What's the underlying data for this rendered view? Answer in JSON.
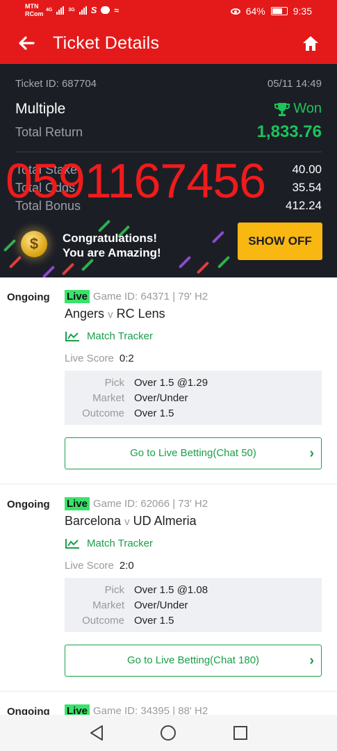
{
  "status_bar": {
    "carrier_top": "MTN",
    "carrier_bottom": "RCom",
    "net1": "4G",
    "net2": "3G",
    "battery_pct": "64%",
    "time": "9:35"
  },
  "header": {
    "title": "Ticket Details"
  },
  "summary": {
    "ticket_id": "Ticket ID: 687704",
    "date": "05/11 14:49",
    "bet_type": "Multiple",
    "result": "Won",
    "total_return_label": "Total Return",
    "total_return": "1,833.76",
    "total_stake_label": "Total Stake",
    "total_stake": "40.00",
    "total_odds_label": "Total Odds",
    "total_odds": "35.54",
    "total_bonus_label": "Total Bonus",
    "total_bonus": "412.24",
    "watermark": "0591167456",
    "congrats_line1": "Congratulations!",
    "congrats_line2": "You are Amazing!",
    "show_off": "SHOW OFF"
  },
  "bets": [
    {
      "state": "Ongoing",
      "live": "Live",
      "game_info": "Game ID: 64371 | 79' H2",
      "home": "Angers",
      "vs": "v",
      "away": "RC Lens",
      "tracker": "Match Tracker",
      "live_score_label": "Live Score",
      "live_score": "0:2",
      "pick_label": "Pick",
      "pick": "Over 1.5 @1.29",
      "market_label": "Market",
      "market": "Over/Under",
      "outcome_label": "Outcome",
      "outcome": "Over 1.5",
      "go_live": "Go to Live Betting(Chat 50)"
    },
    {
      "state": "Ongoing",
      "live": "Live",
      "game_info": "Game ID: 62066 | 73' H2",
      "home": "Barcelona",
      "vs": "v",
      "away": "UD Almeria",
      "tracker": "Match Tracker",
      "live_score_label": "Live Score",
      "live_score": "2:0",
      "pick_label": "Pick",
      "pick": "Over 1.5 @1.08",
      "market_label": "Market",
      "market": "Over/Under",
      "outcome_label": "Outcome",
      "outcome": "Over 1.5",
      "go_live": "Go to Live Betting(Chat 180)"
    },
    {
      "state": "Ongoing",
      "live": "Live",
      "game_info": "Game ID: 34395 | 88' H2"
    }
  ],
  "colors": {
    "brand_red": "#e41a1a",
    "win_green": "#1bc45b",
    "live_green": "#39e36a",
    "dark_bg": "#1c1e26",
    "cta_yellow": "#f8b711"
  }
}
